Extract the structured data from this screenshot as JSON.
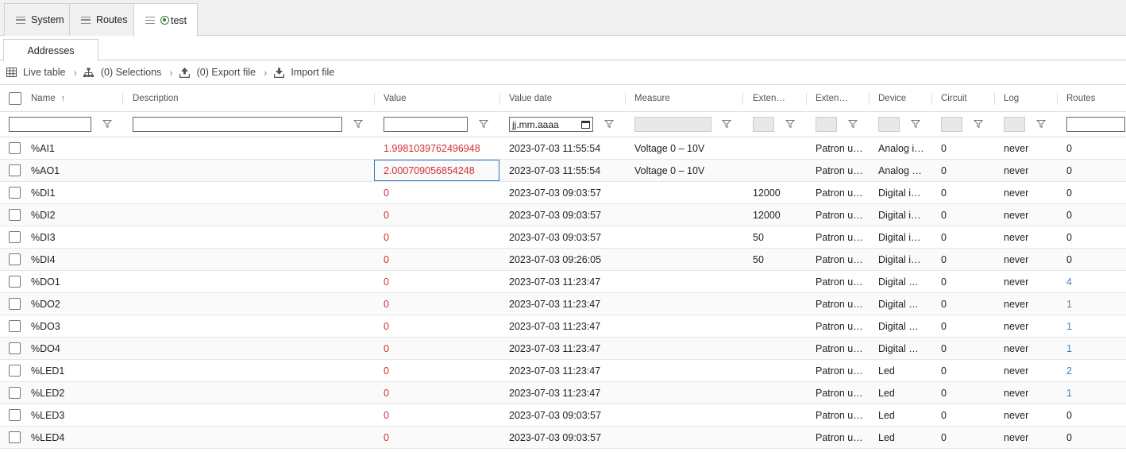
{
  "top_tabs": [
    {
      "label": "System"
    },
    {
      "label": "Routes"
    },
    {
      "label": "test"
    }
  ],
  "sub_tabs": [
    {
      "label": "Addresses"
    }
  ],
  "toolbar": {
    "live_table": "Live table",
    "selections": "(0) Selections",
    "export": "(0) Export file",
    "import": "Import file"
  },
  "columns": {
    "name": "Name",
    "description": "Description",
    "value": "Value",
    "value_date": "Value date",
    "measure": "Measure",
    "extension1": "Exten…",
    "extension2": "Exten…",
    "device": "Device",
    "circuit": "Circuit",
    "log": "Log",
    "routes": "Routes"
  },
  "filters": {
    "date_placeholder": "jj.mm.aaaa"
  },
  "rows": [
    {
      "name": "%AI1",
      "value": "1.9981039762496948",
      "date": "2023-07-03 11:55:54",
      "measure": "Voltage 0 – 10V",
      "ext1": "",
      "ext2": "Patron u…",
      "device": "Analog i…",
      "circuit": "0",
      "log": "never",
      "routes": "0"
    },
    {
      "name": "%AO1",
      "value": "2.000709056854248",
      "date": "2023-07-03 11:55:54",
      "measure": "Voltage 0 – 10V",
      "ext1": "",
      "ext2": "Patron u…",
      "device": "Analog …",
      "circuit": "0",
      "log": "never",
      "routes": "0"
    },
    {
      "name": "%DI1",
      "value": "0",
      "date": "2023-07-03 09:03:57",
      "measure": "",
      "ext1": "12000",
      "ext2": "Patron u…",
      "device": "Digital i…",
      "circuit": "0",
      "log": "never",
      "routes": "0"
    },
    {
      "name": "%DI2",
      "value": "0",
      "date": "2023-07-03 09:03:57",
      "measure": "",
      "ext1": "12000",
      "ext2": "Patron u…",
      "device": "Digital i…",
      "circuit": "0",
      "log": "never",
      "routes": "0"
    },
    {
      "name": "%DI3",
      "value": "0",
      "date": "2023-07-03 09:03:57",
      "measure": "",
      "ext1": "50",
      "ext2": "Patron u…",
      "device": "Digital i…",
      "circuit": "0",
      "log": "never",
      "routes": "0"
    },
    {
      "name": "%DI4",
      "value": "0",
      "date": "2023-07-03 09:26:05",
      "measure": "",
      "ext1": "50",
      "ext2": "Patron u…",
      "device": "Digital i…",
      "circuit": "0",
      "log": "never",
      "routes": "0"
    },
    {
      "name": "%DO1",
      "value": "0",
      "date": "2023-07-03 11:23:47",
      "measure": "",
      "ext1": "",
      "ext2": "Patron u…",
      "device": "Digital …",
      "circuit": "0",
      "log": "never",
      "routes": "4"
    },
    {
      "name": "%DO2",
      "value": "0",
      "date": "2023-07-03 11:23:47",
      "measure": "",
      "ext1": "",
      "ext2": "Patron u…",
      "device": "Digital …",
      "circuit": "0",
      "log": "never",
      "routes": "1"
    },
    {
      "name": "%DO3",
      "value": "0",
      "date": "2023-07-03 11:23:47",
      "measure": "",
      "ext1": "",
      "ext2": "Patron u…",
      "device": "Digital …",
      "circuit": "0",
      "log": "never",
      "routes": "1"
    },
    {
      "name": "%DO4",
      "value": "0",
      "date": "2023-07-03 11:23:47",
      "measure": "",
      "ext1": "",
      "ext2": "Patron u…",
      "device": "Digital …",
      "circuit": "0",
      "log": "never",
      "routes": "1"
    },
    {
      "name": "%LED1",
      "value": "0",
      "date": "2023-07-03 11:23:47",
      "measure": "",
      "ext1": "",
      "ext2": "Patron u…",
      "device": "Led",
      "circuit": "0",
      "log": "never",
      "routes": "2"
    },
    {
      "name": "%LED2",
      "value": "0",
      "date": "2023-07-03 11:23:47",
      "measure": "",
      "ext1": "",
      "ext2": "Patron u…",
      "device": "Led",
      "circuit": "0",
      "log": "never",
      "routes": "1"
    },
    {
      "name": "%LED3",
      "value": "0",
      "date": "2023-07-03 09:03:57",
      "measure": "",
      "ext1": "",
      "ext2": "Patron u…",
      "device": "Led",
      "circuit": "0",
      "log": "never",
      "routes": "0"
    },
    {
      "name": "%LED4",
      "value": "0",
      "date": "2023-07-03 09:03:57",
      "measure": "",
      "ext1": "",
      "ext2": "Patron u…",
      "device": "Led",
      "circuit": "0",
      "log": "never",
      "routes": "0"
    }
  ],
  "colors": {
    "value_red": "#d32f2f",
    "routes_link": "#4a7fb5",
    "status_green": "#2e7d32",
    "focus_blue": "#2b78c2"
  }
}
